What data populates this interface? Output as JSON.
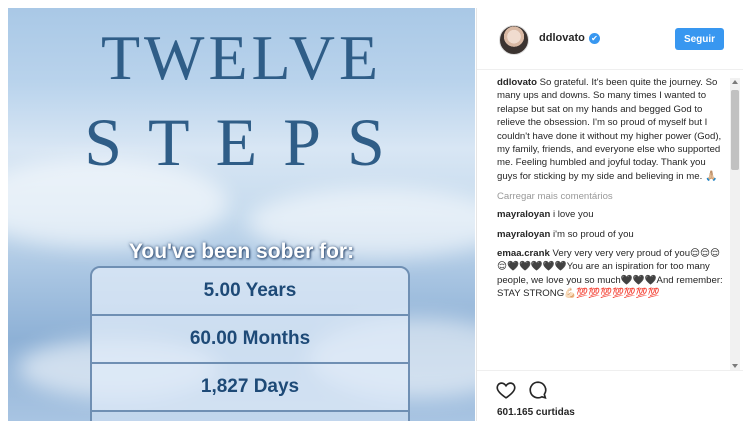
{
  "post_image": {
    "title_line1": "TWELVE",
    "title_line2": "STEPS",
    "sober_heading": "You've been sober for:",
    "counters": [
      "5.00 Years",
      "60.00 Months",
      "1,827 Days"
    ]
  },
  "header": {
    "username": "ddlovato",
    "verified_mark": "✔",
    "follow_label": "Seguir"
  },
  "caption": {
    "username": "ddlovato",
    "text": "So grateful. It's been quite the journey. So many ups and downs. So many times I wanted to relapse but sat on my hands and begged God to relieve the obsession. I'm so proud of myself but I couldn't have done it without my higher power (God), my family, friends, and everyone else who supported me. Feeling humbled and joyful today. Thank you guys for sticking by my side and believing in me.",
    "emoji": "🙏🏼"
  },
  "load_more_label": "Carregar mais comentários",
  "comments": [
    {
      "username": "mayraloyan",
      "text": "i love you"
    },
    {
      "username": "mayraloyan",
      "text": "i'm so proud of you"
    },
    {
      "username": "emaa.crank",
      "text": "Very very very very proud of you😌😌😌😌🖤🖤🖤🖤🖤You are an ispiration for too many people, we love you so much🖤🖤🖤And remember: STAY STRONG💪🏻💯💯💯💯💯💯💯"
    }
  ],
  "likes_text": "601.165 curtidas",
  "icons": {
    "like": "heart-outline-icon",
    "comment": "speech-bubble-icon"
  },
  "colors": {
    "title_blue": "#2f5d87",
    "follow_button": "#3897f0",
    "text": "#262626",
    "muted": "#999999"
  }
}
